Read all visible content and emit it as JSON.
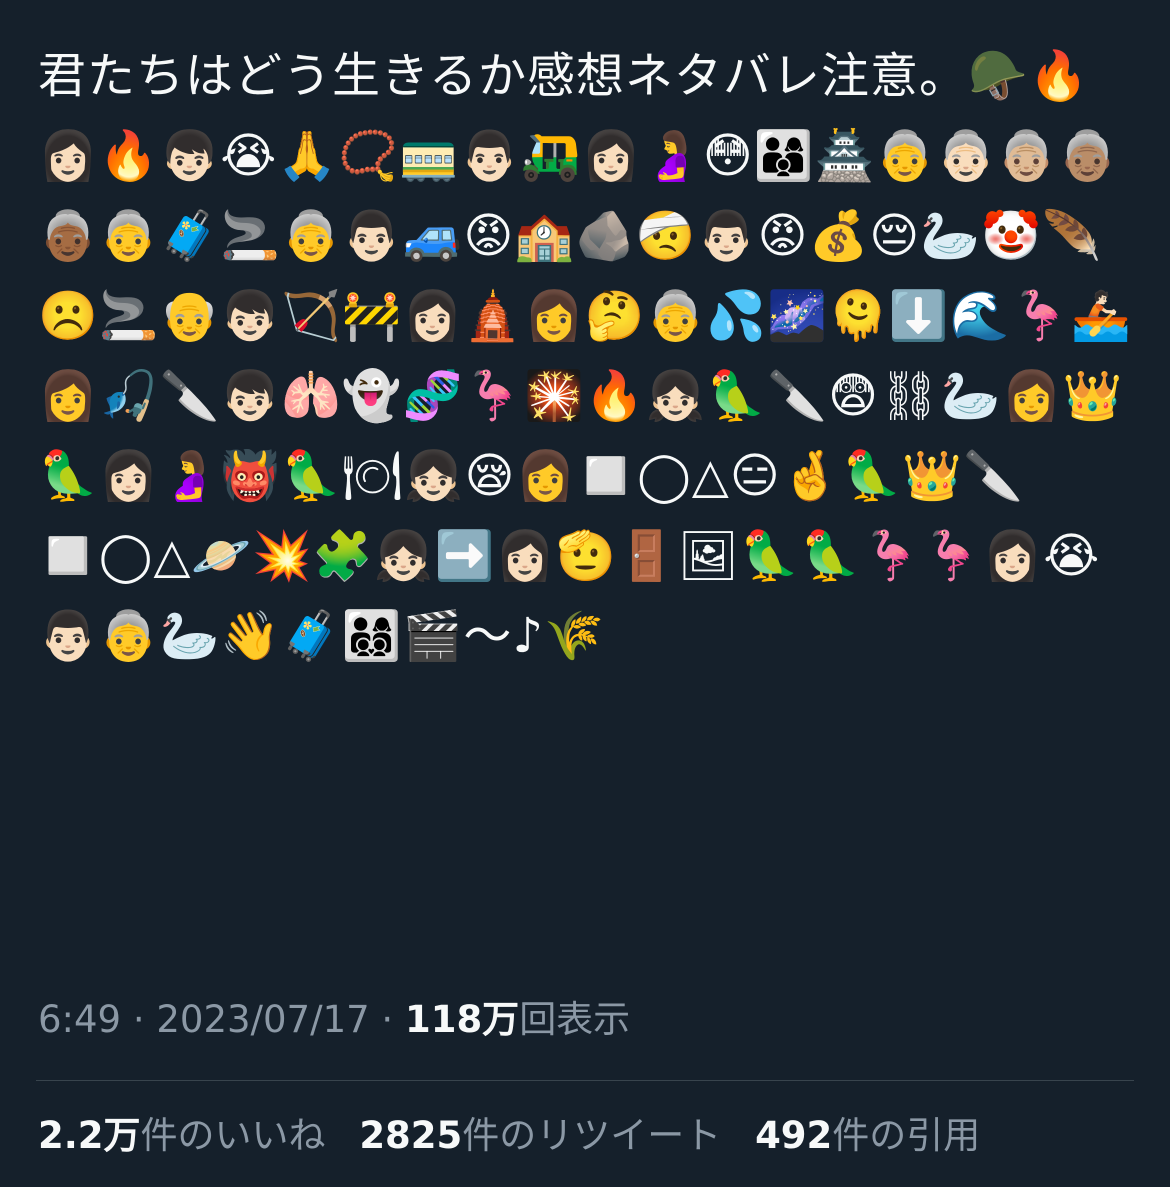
{
  "tweet": {
    "text": "君たちはどう生きるか感想ネタバレ注意。🪖🔥👩🏻🔥👦🏻😭🙏📿🚃👨🏻🛺👩🏻🤰😳👨‍👩‍👦🏯👵👵🏻👵🏼👵🏽👵🏾👵🧳🚬👵👨🏻🚙😡🏫🪨🤕👨🏻😡💰😔🦢🤡🪶☹️🚬👴👦🏻🏹🚧👩🏻🛕👩🤔👵💦🌌🫠⬇️🌊🦩🚣🏻👩🎣🔪👦🏻🫁👻🧬🦩🎇🔥👧🏻🦜🔪😨⛓🦢👩👑🦜👩🏻🤰👹🦜🍽👧🏻😪👩◻️◯△😑🤞🦜👑🔪◻️◯△🪐💥🧩👧🏻➡️👩🏻🫡🚪🖼🦜🦜🦩🦩👩🏻😭👨🏻👵🦢👋🧳👨‍👩‍👦‍👦🎬〜♪🌾"
  },
  "meta": {
    "time": "6:49",
    "separator": " · ",
    "date": "2023/07/17",
    "views_count": "118万",
    "views_label": "回表示"
  },
  "stats": {
    "likes_count": "2.2万",
    "likes_label": "件のいいね",
    "retweets_count": "2825",
    "retweets_label": "件のリツイート",
    "quotes_count": "492",
    "quotes_label": "件の引用"
  },
  "colors": {
    "background": "#15202b",
    "text": "#f7f9f9",
    "secondary": "#8b98a5",
    "divider": "#38444d"
  }
}
